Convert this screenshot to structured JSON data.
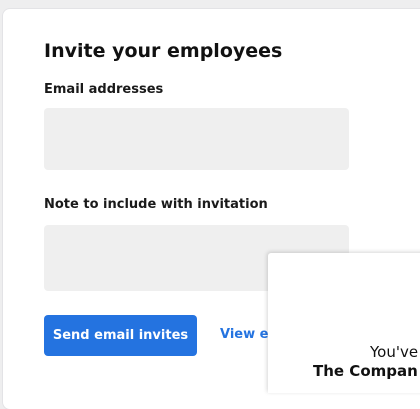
{
  "invite": {
    "title": "Invite your employees",
    "email_label": "Email addresses",
    "email_value": "",
    "email_placeholder": "",
    "note_label": "Note to include with invitation",
    "note_value": "",
    "note_placeholder": "",
    "send_button_label": "Send email invites",
    "view_link_label": "View ex"
  },
  "preview": {
    "line1": "You've",
    "line2": "The Compan"
  },
  "colors": {
    "accent": "#2473e0",
    "field_background": "#efefef",
    "page_background": "#eeeeef"
  }
}
